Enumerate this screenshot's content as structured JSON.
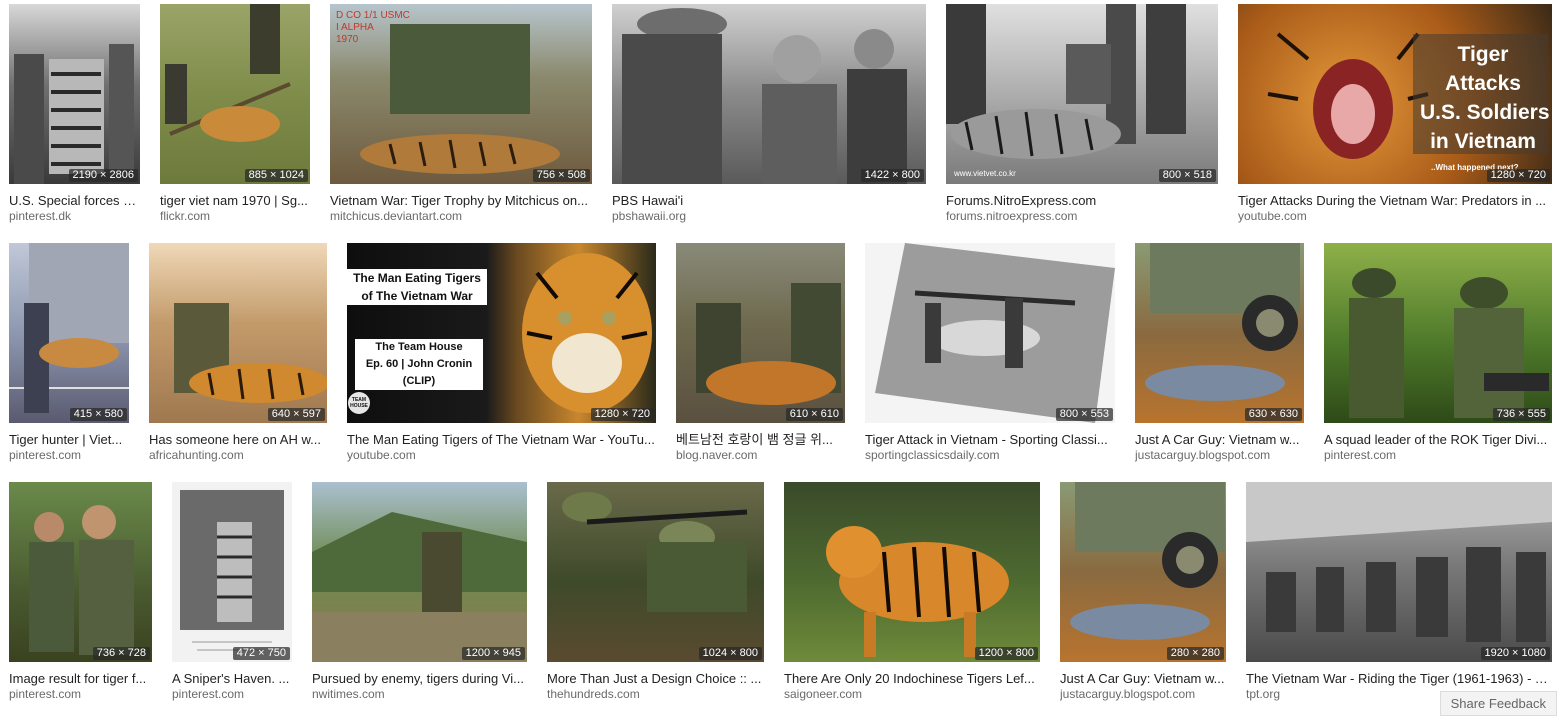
{
  "results": [
    [
      {
        "caption": "U.S. Special forces s...",
        "source": "pinterest.dk",
        "dims": "2190 × 2806"
      },
      {
        "caption": "tiger viet nam 1970 | Sg...",
        "source": "flickr.com",
        "dims": "885 × 1024"
      },
      {
        "caption": "Vietnam War: Tiger Trophy by Mitchicus on...",
        "source": "mitchicus.deviantart.com",
        "dims": "756 × 508"
      },
      {
        "caption": "PBS Hawai'i",
        "source": "pbshawaii.org",
        "dims": "1422 × 800"
      },
      {
        "caption": "Forums.NitroExpress.com",
        "source": "forums.nitroexpress.com",
        "dims": "800 × 518"
      },
      {
        "caption": "Tiger Attacks During the Vietnam War: Predators in ...",
        "source": "youtube.com",
        "dims": "1280 × 720"
      }
    ],
    [
      {
        "caption": "Tiger hunter | Viet...",
        "source": "pinterest.com",
        "dims": "415 × 580"
      },
      {
        "caption": "Has someone here on AH w...",
        "source": "africahunting.com",
        "dims": "640 × 597"
      },
      {
        "caption": "The Man Eating Tigers of The Vietnam War - YouTu...",
        "source": "youtube.com",
        "dims": "1280 × 720"
      },
      {
        "caption": "베트남전 호랑이 뱀 정글 위...",
        "source": "blog.naver.com",
        "dims": "610 × 610"
      },
      {
        "caption": "Tiger Attack in Vietnam - Sporting Classi...",
        "source": "sportingclassicsdaily.com",
        "dims": "800 × 553"
      },
      {
        "caption": "Just A Car Guy: Vietnam w...",
        "source": "justacarguy.blogspot.com",
        "dims": "630 × 630"
      },
      {
        "caption": "A squad leader of the ROK Tiger Divi...",
        "source": "pinterest.com",
        "dims": "736 × 555"
      }
    ],
    [
      {
        "caption": "Image result for tiger f...",
        "source": "pinterest.com",
        "dims": "736 × 728"
      },
      {
        "caption": "A Sniper's Haven. ...",
        "source": "pinterest.com",
        "dims": "472 × 750"
      },
      {
        "caption": "Pursued by enemy, tigers during Vi...",
        "source": "nwitimes.com",
        "dims": "1200 × 945"
      },
      {
        "caption": "More Than Just a Design Choice :: ...",
        "source": "thehundreds.com",
        "dims": "1024 × 800"
      },
      {
        "caption": "There Are Only 20 Indochinese Tigers Lef...",
        "source": "saigoneer.com",
        "dims": "1200 × 800"
      },
      {
        "caption": "Just A Car Guy: Vietnam w...",
        "source": "justacarguy.blogspot.com",
        "dims": "280 × 280"
      },
      {
        "caption": "The Vietnam War - Riding the Tiger (1961-1963) - T...",
        "source": "tpt.org",
        "dims": "1920 × 1080"
      }
    ]
  ],
  "overlays": {
    "usmc_stamp": "D CO 1/1 USMC\nI ALPHA\n1970",
    "tiger_attacks_title": "Tiger\nAttacks\nU.S. Soldiers\nin Vietnam",
    "tiger_attacks_sub": "..What happened next?",
    "man_eating_title": "The Man Eating Tigers\nof The Vietnam War",
    "team_house": "The Team House\nEp. 60 | John Cronin\n(CLIP)",
    "team_house_logo": "TEAM HOUSE",
    "vietvet_watermark": "www.vietvet.co.kr"
  },
  "footer": {
    "share_feedback": "Share Feedback"
  }
}
